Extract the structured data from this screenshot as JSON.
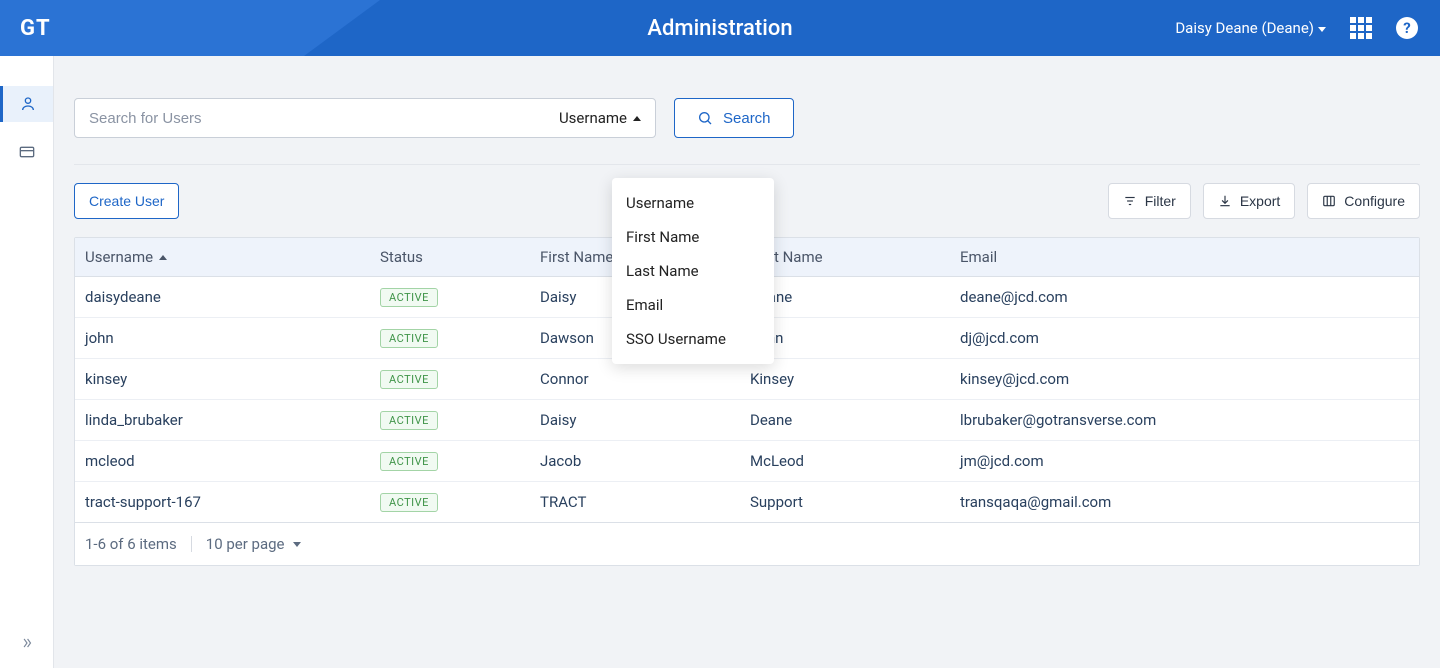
{
  "header": {
    "logo": "GT",
    "title": "Administration",
    "user_label": "Daisy Deane (Deane)"
  },
  "search": {
    "placeholder": "Search for Users",
    "type_selected": "Username",
    "button": "Search",
    "dropdown_options": [
      "Username",
      "First Name",
      "Last Name",
      "Email",
      "SSO Username"
    ]
  },
  "actions": {
    "create": "Create User",
    "filter": "Filter",
    "export": "Export",
    "configure": "Configure"
  },
  "table": {
    "columns": [
      "Username",
      "Status",
      "First Name",
      "Last Name",
      "Email"
    ],
    "sorted_column": "Username",
    "status_badge": "ACTIVE",
    "rows": [
      {
        "username": "daisydeane",
        "first": "Daisy",
        "last": "Deane",
        "email": "deane@jcd.com"
      },
      {
        "username": "john",
        "first": "Dawson",
        "last": "John",
        "email": "dj@jcd.com"
      },
      {
        "username": "kinsey",
        "first": "Connor",
        "last": "Kinsey",
        "email": "kinsey@jcd.com"
      },
      {
        "username": "linda_brubaker",
        "first": "Daisy",
        "last": "Deane",
        "email": "lbrubaker@gotransverse.com"
      },
      {
        "username": "mcleod",
        "first": "Jacob",
        "last": "McLeod",
        "email": "jm@jcd.com"
      },
      {
        "username": "tract-support-167",
        "first": "TRACT",
        "last": "Support",
        "email": "transqaqa@gmail.com"
      }
    ],
    "footer": {
      "range": "1-6 of 6 items",
      "per_page": "10 per page"
    }
  }
}
